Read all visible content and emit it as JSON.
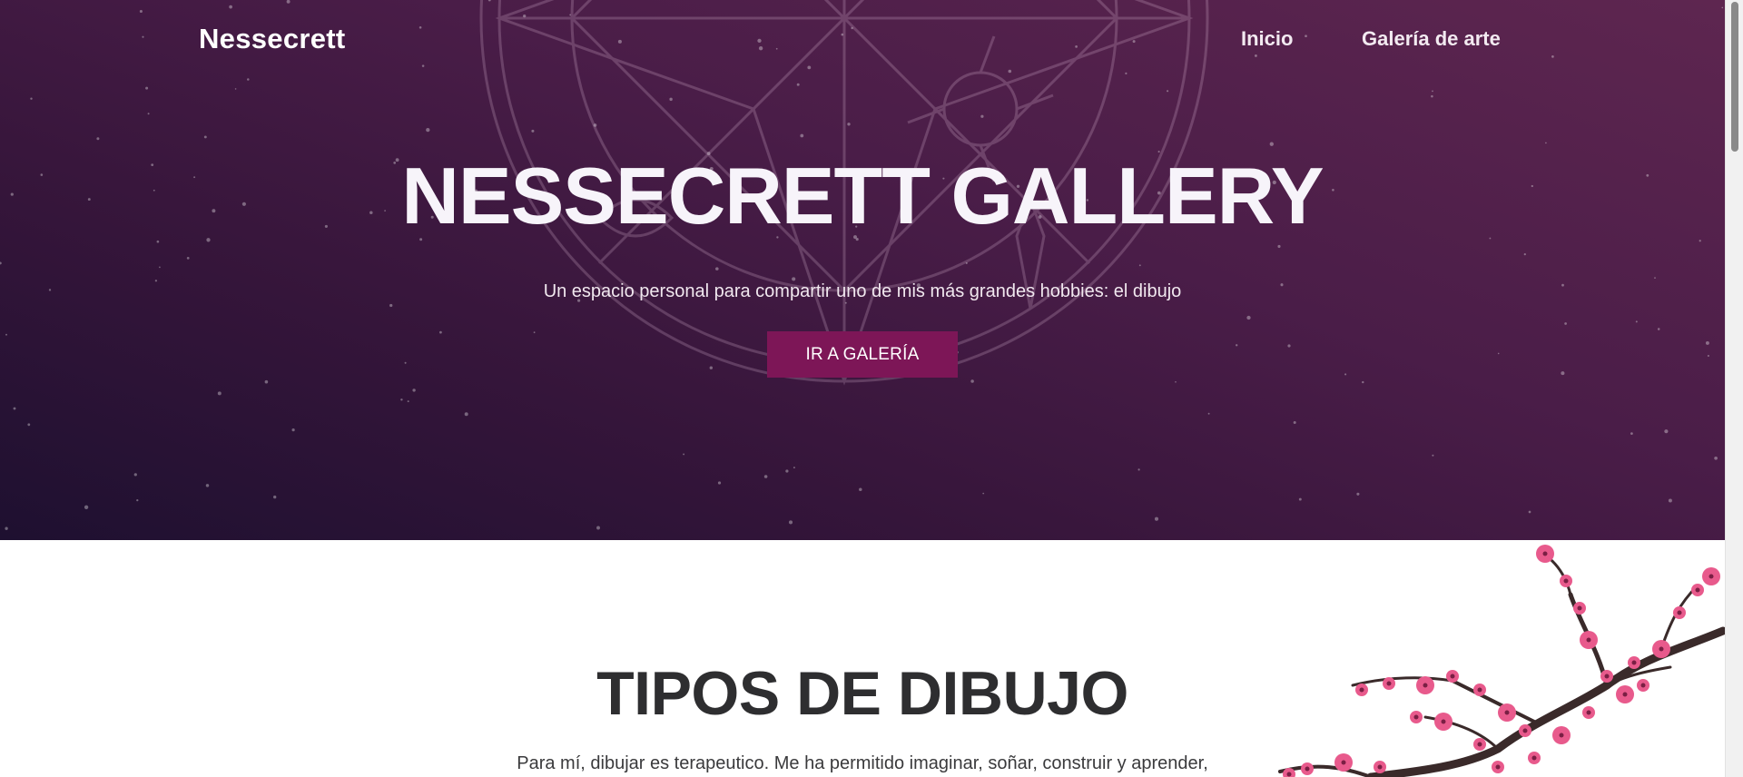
{
  "nav": {
    "brand": "Nessecrett",
    "links": [
      {
        "label": "Inicio"
      },
      {
        "label": "Galería de arte"
      }
    ]
  },
  "hero": {
    "title": "NESSECRETT GALLERY",
    "subtitle": "Un espacio personal para compartir uno de mis más grandes hobbies: el dibujo",
    "cta_label": "IR A GALERÍA"
  },
  "section": {
    "title": "TIPOS DE DIBUJO",
    "text": "Para mí, dibujar es terapeutico. Me ha permitido imaginar, soñar, construir y aprender,"
  },
  "colors": {
    "hero_gradient_top": "#5e2650",
    "hero_gradient_bottom": "#1e1030",
    "cta_background": "#7d1657",
    "blossom_pink": "#e85a8c",
    "branch": "#3a2a2a"
  },
  "icons": {
    "hero_decoration": "magic-circle-emblem-icon",
    "section_decoration": "cherry-blossom-branch-icon"
  }
}
